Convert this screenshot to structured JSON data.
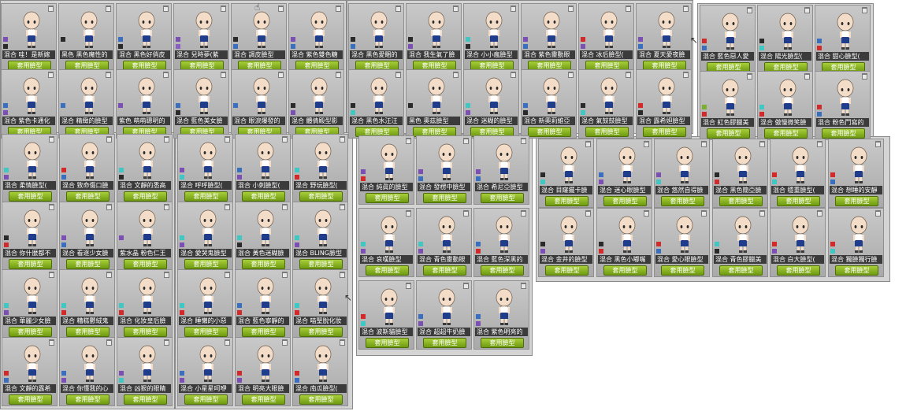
{
  "apply_label": "套用臉型",
  "groups": [
    {
      "cards": [
        {
          "name": "混合 哇！是新嫁",
          "swatches": [
            "#7b4fb4",
            "#2a2a2a"
          ]
        },
        {
          "name": "黑色 黑色魔性的",
          "swatches": [
            "#2a2a2a"
          ]
        },
        {
          "name": "混合 黑色好俏皮",
          "swatches": [
            "#3a6fc0",
            "#2a2a2a"
          ]
        },
        {
          "name": "混合 兒時夢(紫",
          "swatches": [
            "#7b4fb4",
            "#8a5fc4"
          ]
        },
        {
          "name": "混合 調皮臉型",
          "swatches": [
            "#2a2a2a",
            "#3a6fc0"
          ]
        },
        {
          "name": "混合 紫色雙色糖",
          "swatches": [
            "#7b4fb4",
            "#3a6fc0"
          ]
        },
        {
          "name": "混合 紫色卡通化",
          "swatches": [
            "#3a6fc0",
            "#7b4fb4"
          ]
        },
        {
          "name": "混合 精緻的臉型",
          "swatches": [
            "#3a6fc0"
          ]
        },
        {
          "name": "紫色 萌萌聰明的",
          "swatches": [
            "#7b4fb4"
          ]
        },
        {
          "name": "混合 藍色美女臉",
          "swatches": [
            "#3a6fc0",
            "#2a2a2a"
          ]
        },
        {
          "name": "混合 眼淚爆發的",
          "swatches": [
            "#3a6fc0"
          ]
        },
        {
          "name": "混合 體倩殿型影",
          "swatches": [
            "#2a2a2a",
            "#7b4fb4"
          ]
        }
      ]
    },
    {
      "cards": [
        {
          "name": "混合 黑色愛睏的",
          "swatches": [
            "#2a2a2a",
            "#3a6fc0"
          ]
        },
        {
          "name": "混合 我生氣了臉",
          "swatches": [
            "#2a2a2a",
            "#7b4fb4"
          ]
        },
        {
          "name": "混合 小小瘋臉型",
          "swatches": [
            "#3fc7c4",
            "#2a2a2a"
          ]
        },
        {
          "name": "混合 紫色靈動眼",
          "swatches": [
            "#7b4fb4",
            "#3a6fc0"
          ]
        },
        {
          "name": "混合 冰后臉型(",
          "swatches": [
            "#d22a2a",
            "#7b4fb4"
          ]
        },
        {
          "name": "混合 夏天愛夜臉",
          "swatches": [
            "#7b4fb4",
            "#3a6fc0"
          ]
        },
        {
          "name": "混合 黑色水汪汪",
          "swatches": [
            "#2a2a2a",
            "#3fc7c4"
          ]
        },
        {
          "name": "黑色 奧茲臉型",
          "swatches": [
            "#2a2a2a"
          ]
        },
        {
          "name": "混合 迷糊的臉型",
          "swatches": [
            "#3fc7c4",
            "#7b4fb4"
          ]
        },
        {
          "name": "混合 新奧莉維亞",
          "swatches": [
            "#3a6fc0",
            "#2a2a2a"
          ]
        },
        {
          "name": "混合 氣鼓鼓臉型",
          "swatches": [
            "#2a2a2a",
            "#3fc7c4"
          ]
        },
        {
          "name": "混合 露希妲臉型",
          "swatches": [
            "#d22a2a",
            "#2a2a2a"
          ]
        }
      ]
    },
    {
      "cards": [
        {
          "name": "混合 藍色惡人愛",
          "swatches": [
            "#d22a2a",
            "#3a6fc0"
          ]
        },
        {
          "name": "混合 陽光臉型(",
          "swatches": [
            "#2a2a2a",
            "#3fc7c4"
          ]
        },
        {
          "name": "混合 甜心臉型(",
          "swatches": [
            "#3a6fc0",
            "#d22a2a"
          ]
        },
        {
          "name": "混合 紅色膠臘美",
          "swatches": [
            "#7bb02a",
            "#d22a2a"
          ]
        },
        {
          "name": "混合 傲慢微笑臉",
          "swatches": [
            "#3fc7c4",
            "#d22a2a"
          ]
        },
        {
          "name": "混合 粉色鬥寫的",
          "swatches": [
            "#d22a2a",
            "#3a6fc0"
          ]
        }
      ]
    },
    {
      "cards": [
        {
          "name": "混合 柔情臉型(",
          "swatches": [
            "#3fc7c4",
            "#7b4fb4"
          ]
        },
        {
          "name": "混合 致命傷口臉",
          "swatches": [
            "#d22a2a",
            "#3a6fc0"
          ]
        },
        {
          "name": "混合 文靜的悉高",
          "swatches": [
            "#3fc7c4",
            "#2a2a2a"
          ]
        },
        {
          "name": "混合 你什麼都不",
          "swatches": [
            "#2a2a2a",
            "#d22a2a"
          ]
        },
        {
          "name": "混合 看逐少女臉",
          "swatches": [
            "#7b4fb4",
            "#3a6fc0"
          ]
        },
        {
          "name": "紫水晶 粉色仁王",
          "swatches": [
            "#7b4fb4"
          ]
        },
        {
          "name": "混合 華麗少女臉",
          "swatches": [
            "#3fc7c4",
            "#7b4fb4"
          ]
        },
        {
          "name": "混合 糟糕鬱絨鬼",
          "swatches": [
            "#3fc7c4",
            "#d22a2a"
          ]
        },
        {
          "name": "混合 化妝皇后臉",
          "swatches": [
            "#3fc7c4",
            "#d22a2a"
          ]
        },
        {
          "name": "混合 文靜的露希",
          "swatches": [
            "#d22a2a",
            "#3a6fc0"
          ]
        },
        {
          "name": "混合 你懂我的心",
          "swatches": [
            "#3a6fc0",
            "#7b4fb4"
          ]
        },
        {
          "name": "混合 凶狠的眼睛",
          "swatches": [
            "#7b4fb4",
            "#3fc7c4"
          ]
        }
      ]
    },
    {
      "cards": [
        {
          "name": "混合 呼呼臉型(",
          "swatches": [
            "#7b4fb4",
            "#3fc7c4"
          ]
        },
        {
          "name": "混合 小刺臉型(",
          "swatches": [
            "#3a6fc0",
            "#7b4fb4"
          ]
        },
        {
          "name": "混合 野玩臉型(",
          "swatches": [
            "#3fc7c4",
            "#d22a2a"
          ]
        },
        {
          "name": "混合 愛哭鬼臉型",
          "swatches": [
            "#3fc7c4",
            "#7b4fb4"
          ]
        },
        {
          "name": "混合 黃色迷糊臉",
          "swatches": [
            "#3fc7c4",
            "#2a2a2a"
          ]
        },
        {
          "name": "混合 BLING臉型",
          "swatches": [
            "#3fc7c4",
            "#7b4fb4"
          ]
        },
        {
          "name": "混合 睡懶的小惡",
          "swatches": [
            "#3fc7c4",
            "#d22a2a"
          ]
        },
        {
          "name": "混合 藍色寧靜的",
          "swatches": [
            "#3a6fc0",
            "#d22a2a"
          ]
        },
        {
          "name": "混合 喵聖脫化妝",
          "swatches": [
            "#3fc7c4",
            "#d22a2a"
          ]
        },
        {
          "name": "混合 小星星呵咿",
          "swatches": [
            "#3a6fc0",
            "#7b4fb4"
          ]
        },
        {
          "name": "混合 明亮大眼臉",
          "swatches": [
            "#d22a2a",
            "#7b4fb4"
          ]
        },
        {
          "name": "混合 南瓜臉型(",
          "swatches": [
            "#d22a2a",
            "#3a6fc0"
          ]
        }
      ]
    },
    {
      "cards": [
        {
          "name": "混合 純眞的臉型",
          "swatches": [
            "#7b4fb4",
            "#d22a2a"
          ]
        },
        {
          "name": "混合 發楞中臉型",
          "swatches": [
            "#7b4fb4",
            "#3a6fc0"
          ]
        },
        {
          "name": "混合 希尼亞臉型",
          "swatches": [
            "#7b4fb4",
            "#3a6fc0"
          ]
        },
        {
          "name": "混合 哀嘆臉型",
          "swatches": [
            "#3fc7c4",
            "#7b4fb4"
          ]
        },
        {
          "name": "混合 青色靈動眼",
          "swatches": [
            "#3fc7c4",
            "#7b4fb4"
          ]
        },
        {
          "name": "混合 藍色深黑的",
          "swatches": [
            "#3a6fc0",
            "#d22a2a"
          ]
        },
        {
          "name": "混合 波斯貓臉型",
          "swatches": [
            "#d22a2a",
            "#3fc7c4"
          ]
        },
        {
          "name": "混合 超超牛奶臉",
          "swatches": [
            "#3a6fc0",
            "#7b4fb4"
          ]
        },
        {
          "name": "混合 紫色明亮的",
          "swatches": [
            "#3a6fc0",
            "#7b4fb4"
          ]
        }
      ]
    },
    {
      "cards": [
        {
          "name": "混合 目窿擺卡臉",
          "swatches": [
            "#2a2a2a",
            "#3fc7c4"
          ]
        },
        {
          "name": "混合 迷心眼臉型",
          "swatches": [
            "#3a6fc0",
            "#7b4fb4"
          ]
        },
        {
          "name": "混合 悠然自得臉",
          "swatches": [
            "#7b4fb4",
            "#3fc7c4"
          ]
        },
        {
          "name": "混合 黑色簡亞臉",
          "swatches": [
            "#2a2a2a",
            "#d22a2a"
          ]
        },
        {
          "name": "混合 穩重臉型(",
          "swatches": [
            "#d22a2a",
            "#3fc7c4"
          ]
        },
        {
          "name": "混合 想睡的安靜",
          "swatches": [
            "#d22a2a",
            "#3a6fc0"
          ]
        },
        {
          "name": "混合 金井的臉型",
          "swatches": [
            "#2a2a2a",
            "#7b4fb4"
          ]
        },
        {
          "name": "混合 黑色小嘟嘴",
          "swatches": [
            "#2a2a2a",
            "#d22a2a"
          ]
        },
        {
          "name": "混合 愛心眼臉型",
          "swatches": [
            "#d22a2a",
            "#3a6fc0"
          ]
        },
        {
          "name": "混合 青色膠臘美",
          "swatches": [
            "#3fc7c4",
            "#2a2a2a"
          ]
        },
        {
          "name": "混合 白大臉型(",
          "swatches": [
            "#d22a2a",
            "#7b4fb4"
          ]
        },
        {
          "name": "混合 獨臉獨行臉",
          "swatches": [
            "#d22a2a",
            "#3fc7c4"
          ]
        }
      ]
    }
  ]
}
